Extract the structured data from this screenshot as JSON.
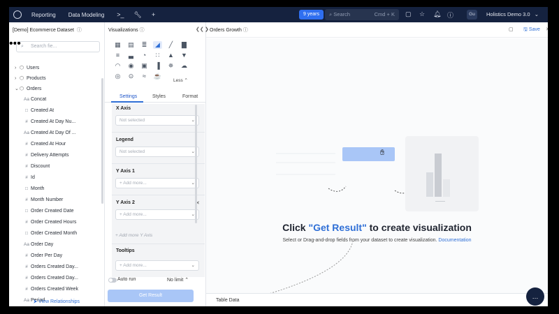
{
  "topnav": {
    "links": [
      "Reporting",
      "Data Modeling"
    ],
    "years_badge": "9 years",
    "search_placeholder": "Search",
    "search_shortcut": "Cmd + K",
    "avatar": "Gu",
    "workspace": "Holistics Demo 3.0"
  },
  "dataset": {
    "title": "[Demo] Ecommerce Dataset",
    "search_placeholder": "Search fie...",
    "models": [
      {
        "label": "Users",
        "expanded": false
      },
      {
        "label": "Products",
        "expanded": false
      },
      {
        "label": "Orders",
        "expanded": true
      }
    ],
    "fields": [
      {
        "type": "Aa",
        "label": "Concat"
      },
      {
        "type": "cal",
        "label": "Created At"
      },
      {
        "type": "#",
        "label": "Created At Day Nu..."
      },
      {
        "type": "Aa",
        "label": "Created At Day Of ..."
      },
      {
        "type": "#",
        "label": "Created At Hour"
      },
      {
        "type": "#",
        "label": "Delivery Attempts"
      },
      {
        "type": "#",
        "label": "Discount"
      },
      {
        "type": "#",
        "label": "Id"
      },
      {
        "type": "cal",
        "label": "Month"
      },
      {
        "type": "#",
        "label": "Month Number"
      },
      {
        "type": "cal",
        "label": "Order Created Date"
      },
      {
        "type": "#",
        "label": "Order Created Hours"
      },
      {
        "type": "cal",
        "label": "Order Created Month"
      },
      {
        "type": "Aa",
        "label": "Order Day"
      },
      {
        "type": "#",
        "label": "Order Per Day"
      },
      {
        "type": "#",
        "label": "Orders Created Day..."
      },
      {
        "type": "#",
        "label": "Orders Created Day..."
      },
      {
        "type": "#",
        "label": "Orders Created Week"
      },
      {
        "type": "Aa",
        "label": "Period"
      }
    ],
    "view_relationships": "View Relationships"
  },
  "viz_panel": {
    "title": "Visualizations",
    "less_label": "Less",
    "tabs": [
      "Settings",
      "Styles",
      "Format"
    ],
    "sections": {
      "x_axis": {
        "title": "X Axis",
        "placeholder": "Not selected"
      },
      "legend": {
        "title": "Legend",
        "placeholder": "Not selected"
      },
      "y_axis_1": {
        "title": "Y Axis 1",
        "placeholder": "+ Add more..."
      },
      "y_axis_2": {
        "title": "Y Axis 2",
        "placeholder": "+ Add more..."
      },
      "add_more_y": "+ Add more Y Axis",
      "tooltips": {
        "title": "Tooltips",
        "placeholder": "+ Add more..."
      }
    },
    "auto_run": "Auto run",
    "no_limit": "No limit",
    "get_result": "Get Result"
  },
  "canvas": {
    "title": "Orders Growth",
    "save": "Save",
    "cta_prefix": "Click ",
    "cta_highlight": "\"Get Result\"",
    "cta_suffix": " to create visualization",
    "cta_sub": "Select or Drag-and-drop fields from your dataset to create visualization.",
    "doc_link": "Documentation",
    "table_data": "Table Data"
  },
  "colors": {
    "nav_bg": "#15223f",
    "accent": "#2f6fd6",
    "years_badge": "#2f6ff0",
    "get_result_disabled": "#a9c6f7"
  }
}
